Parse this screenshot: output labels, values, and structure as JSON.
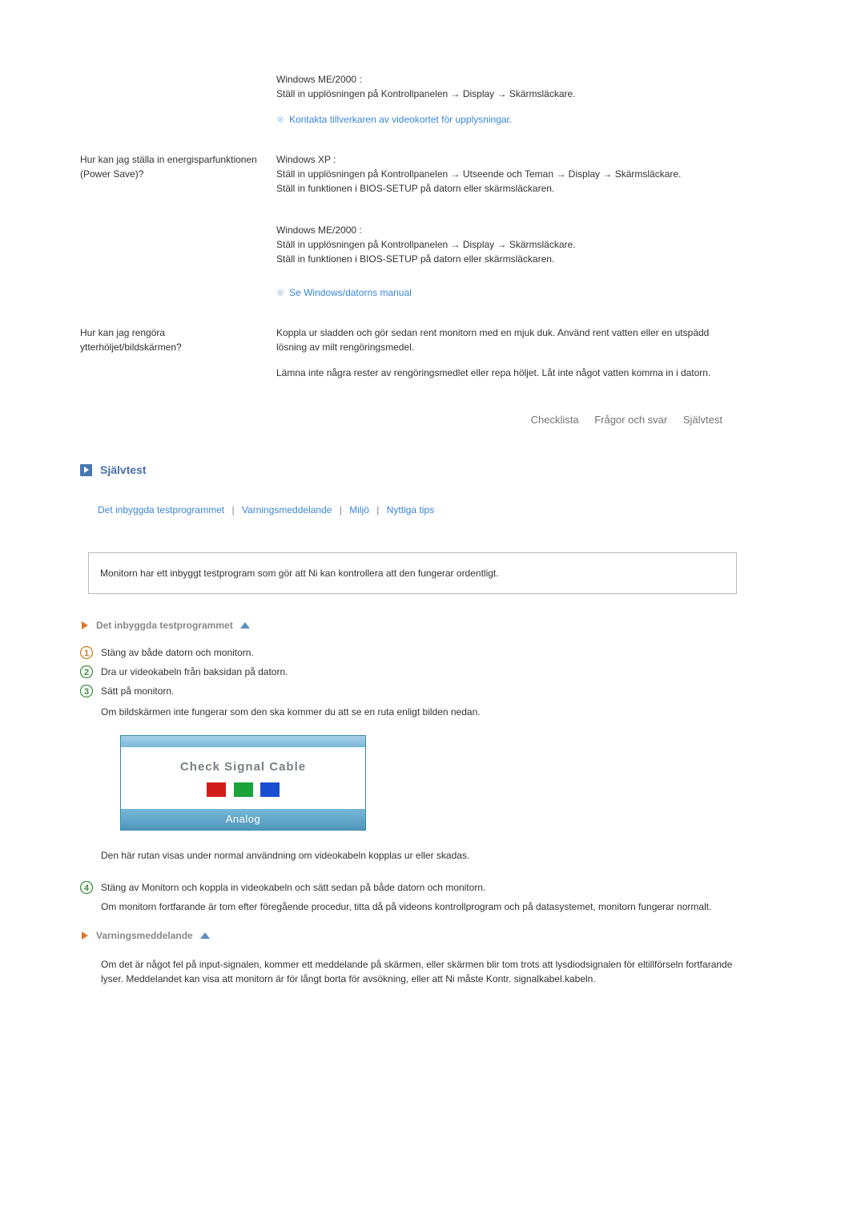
{
  "faq": {
    "q_power": "Hur kan jag ställa in energisparfunktionen (Power Save)?",
    "a_me_top_1": "Windows ME/2000 :",
    "a_me_top_2": "Ställ in upplösningen på Kontrollpanelen → Display → Skärmsläckare.",
    "note_video": "Kontakta tillverkaren av videokortet för upplysningar.",
    "a_xp_1": "Windows XP :",
    "a_xp_2": "Ställ in upplösningen på Kontrollpanelen → Utseende och Teman → Display → Skärmsläckare.",
    "a_xp_3": "Ställ in funktionen i BIOS-SETUP på datorn eller skärmsläckaren.",
    "a_me_1": "Windows ME/2000 :",
    "a_me_2": "Ställ in upplösningen på Kontrollpanelen → Display → Skärmsläckare.",
    "a_me_3": "Ställ in funktionen i BIOS-SETUP på datorn eller skärmsläckaren.",
    "note_manual": "Se Windows/datorns manual",
    "q_clean": "Hur kan jag rengöra ytterhöljet/bildskärmen?",
    "a_clean_1": "Koppla ur sladden och gör sedan rent monitorn med en mjuk duk. Använd rent vatten eller en utspädd lösning av milt rengöringsmedel.",
    "a_clean_2": "Lämna inte några rester av rengöringsmedlet eller repa höljet. Låt inte något vatten komma in i datorn."
  },
  "nav": {
    "item1": "Checklista",
    "item2": "Frågor och svar",
    "item3": "Självtest"
  },
  "section": {
    "selftest": "Självtest",
    "link1": "Det inbyggda testprogrammet",
    "link2": "Varningsmeddelande",
    "link3": "Miljö",
    "link4": "Nyttiga tips",
    "box_text": "Monitorn har ett inbyggt testprogram som gör att Ni kan kontrollera att den fungerar ordentligt.",
    "sub_builtin": "Det inbyggda testprogrammet",
    "step1": "Stäng av både datorn och monitorn.",
    "step2": "Dra ur videokabeln från baksidan på datorn.",
    "step3": "Sätt på monitorn.",
    "step3_para": "Om bildskärmen inte fungerar som den ska kommer du att se en ruta enligt bilden nedan.",
    "signal_title": "Check Signal Cable",
    "signal_mode": "Analog",
    "below_box": "Den här rutan visas under normal användning om videokabeln kopplas ur eller skadas.",
    "step4": "Stäng av Monitorn och koppla in videokabeln och sätt sedan på både datorn och monitorn.",
    "step4_para": "Om monitorn fortfarande är tom efter föregående procedur, titta då på videons kontrollprogram och på datasystemet, monitorn fungerar normalt.",
    "sub_warning": "Varningsmeddelande",
    "warning_text": "Om det är något fel på input-signalen, kommer ett meddelande på skärmen, eller skärmen blir tom trots att lysdiodsignalen för eltillförseln fortfarande lyser. Meddelandet kan visa att monitorn är för långt borta för avsökning, eller att Ni måste Kontr. signalkabel.kabeln."
  },
  "colors": {
    "red": "#d21c1c",
    "green": "#1aa338",
    "blue": "#1a4fd2"
  }
}
